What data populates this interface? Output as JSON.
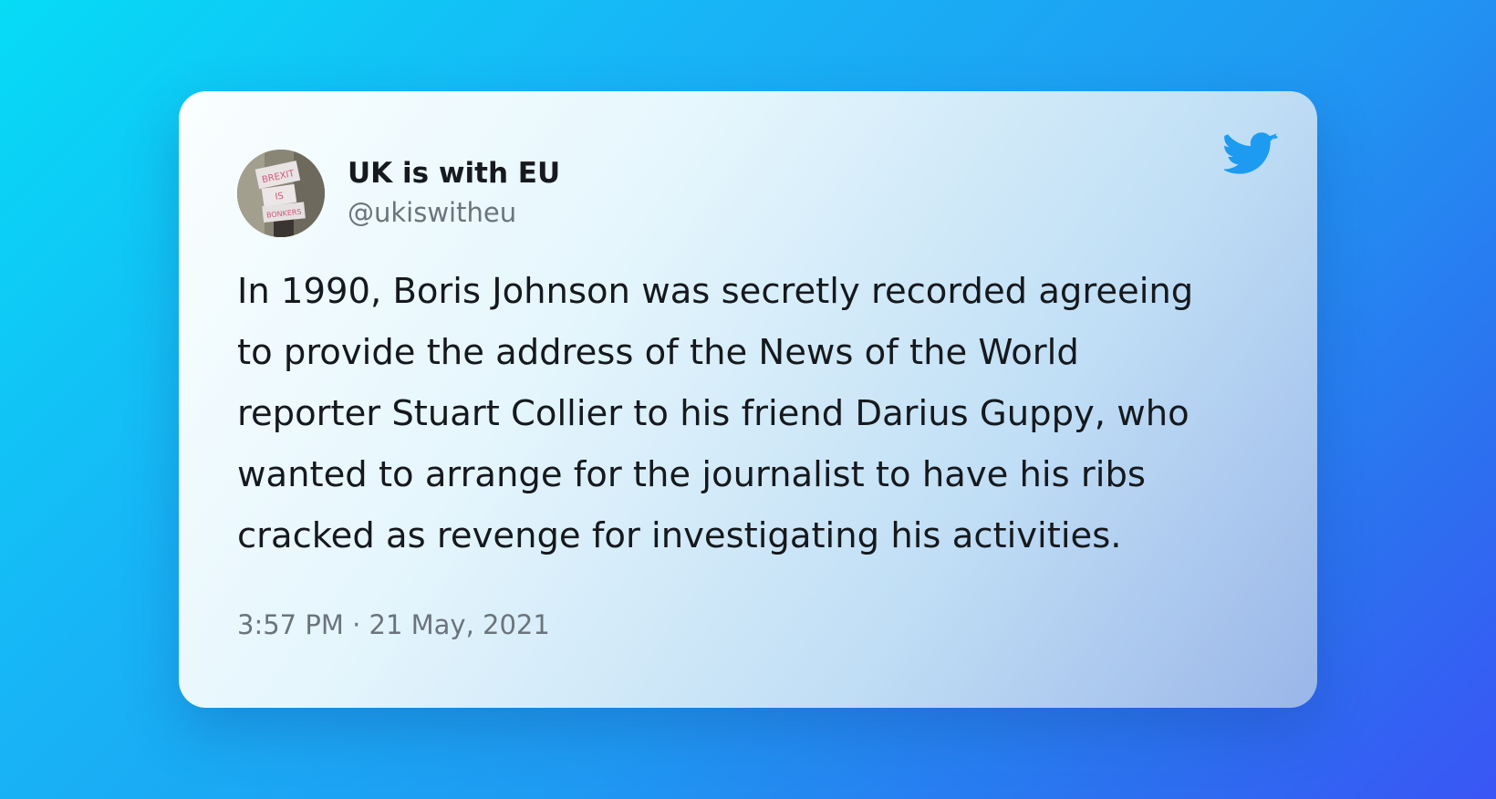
{
  "tweet": {
    "author": {
      "display_name": "UK is with EU",
      "handle": "@ukiswitheu",
      "avatar_sign_text": [
        "BREXIT",
        "IS",
        "BONKERS"
      ]
    },
    "text": "In 1990, Boris Johnson was secretly recorded agreeing to provide the address of the News of the World reporter Stuart Collier to his friend Darius Guppy, who wanted to arrange for the journalist to have his ribs cracked as revenge for investigating his activities.",
    "timestamp": "3:57 PM · 21 May, 2021",
    "platform_icon": "twitter-bird-icon"
  },
  "colors": {
    "twitter_blue": "#1d9bf0",
    "name_text": "#161a1e",
    "muted_text": "#6b747c"
  }
}
